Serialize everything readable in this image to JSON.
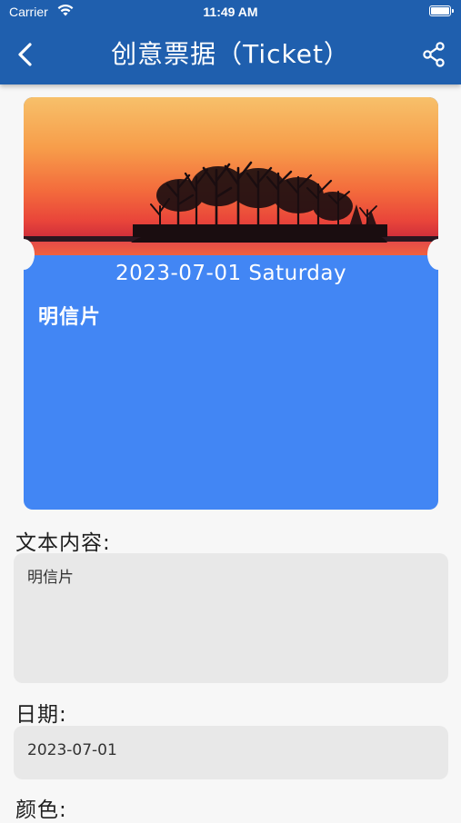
{
  "status_bar": {
    "carrier": "Carrier",
    "time": "11:49 AM"
  },
  "app_bar": {
    "title": "创意票据（Ticket）",
    "background": "#1f5fae",
    "back_icon": "chevron-left-icon",
    "share_icon": "share-icon"
  },
  "ticket": {
    "image": "sunset-lake-island-photo",
    "date": "2023-07-01 Saturday",
    "text": "明信片",
    "color": "#4286f4"
  },
  "form": {
    "text_label": "文本内容:",
    "text_value": "明信片",
    "date_label": "日期:",
    "date_value": "2023-07-01",
    "color_label": "颜色:"
  }
}
